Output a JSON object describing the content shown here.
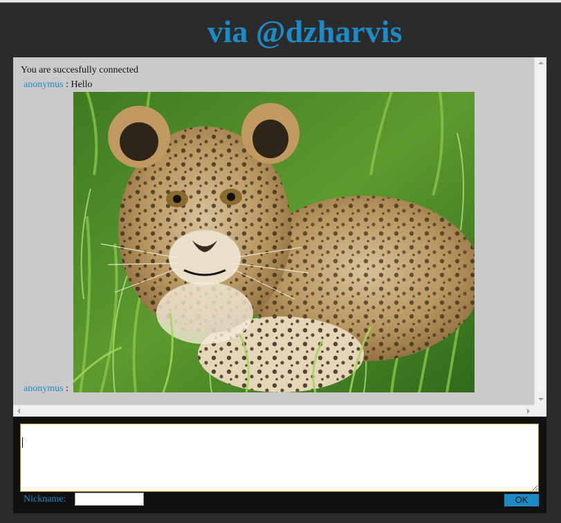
{
  "header": {
    "title": "via @dzharvis"
  },
  "chat": {
    "system_message": "You are succesfully connected",
    "messages": [
      {
        "nick": "anonymus",
        "separator": " : ",
        "text": "Hello"
      },
      {
        "nick": "anonymus",
        "separator": " : ",
        "text": ""
      }
    ],
    "image": {
      "subject": "leopard cub in green grass"
    }
  },
  "composer": {
    "message_value": "",
    "nickname_label": "Nickname:",
    "nickname_value": "",
    "ok_label": "OK"
  },
  "colors": {
    "accent": "#1d8ac8",
    "background": "#2b2b2b",
    "chat_background": "#cacaca",
    "input_panel": "#111111",
    "focus_border": "#b8860b"
  }
}
